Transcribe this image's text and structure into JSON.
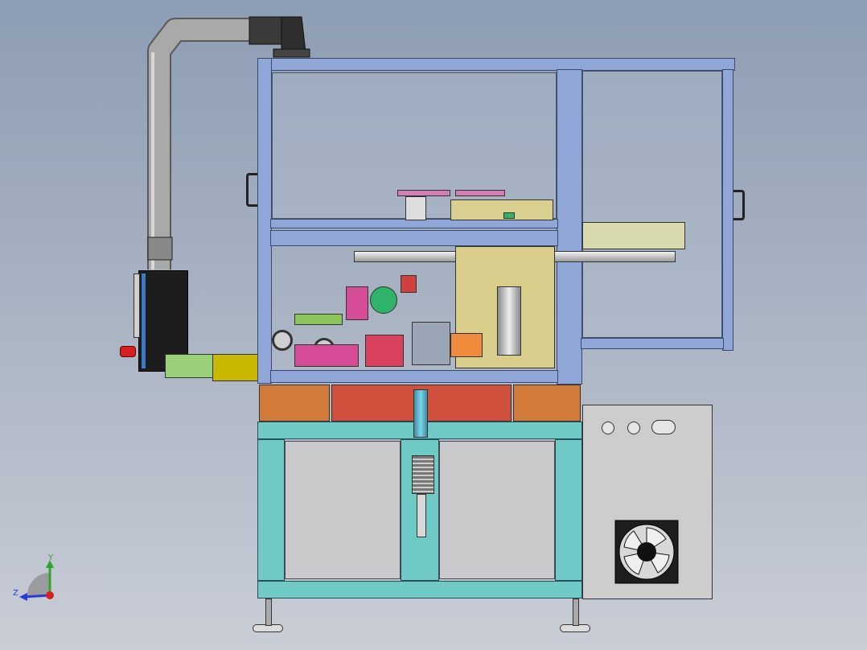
{
  "viewport": {
    "name": "cad-assembly-viewport"
  },
  "triad": {
    "y_label": "Y",
    "z_label": "Z"
  },
  "colors": {
    "frame": "#8fa6d6",
    "base": "#6fcac6",
    "orange": "#d27a3a",
    "red": "#d0503e",
    "cabinet": "#c9c9cb",
    "estop": "#d62020"
  }
}
